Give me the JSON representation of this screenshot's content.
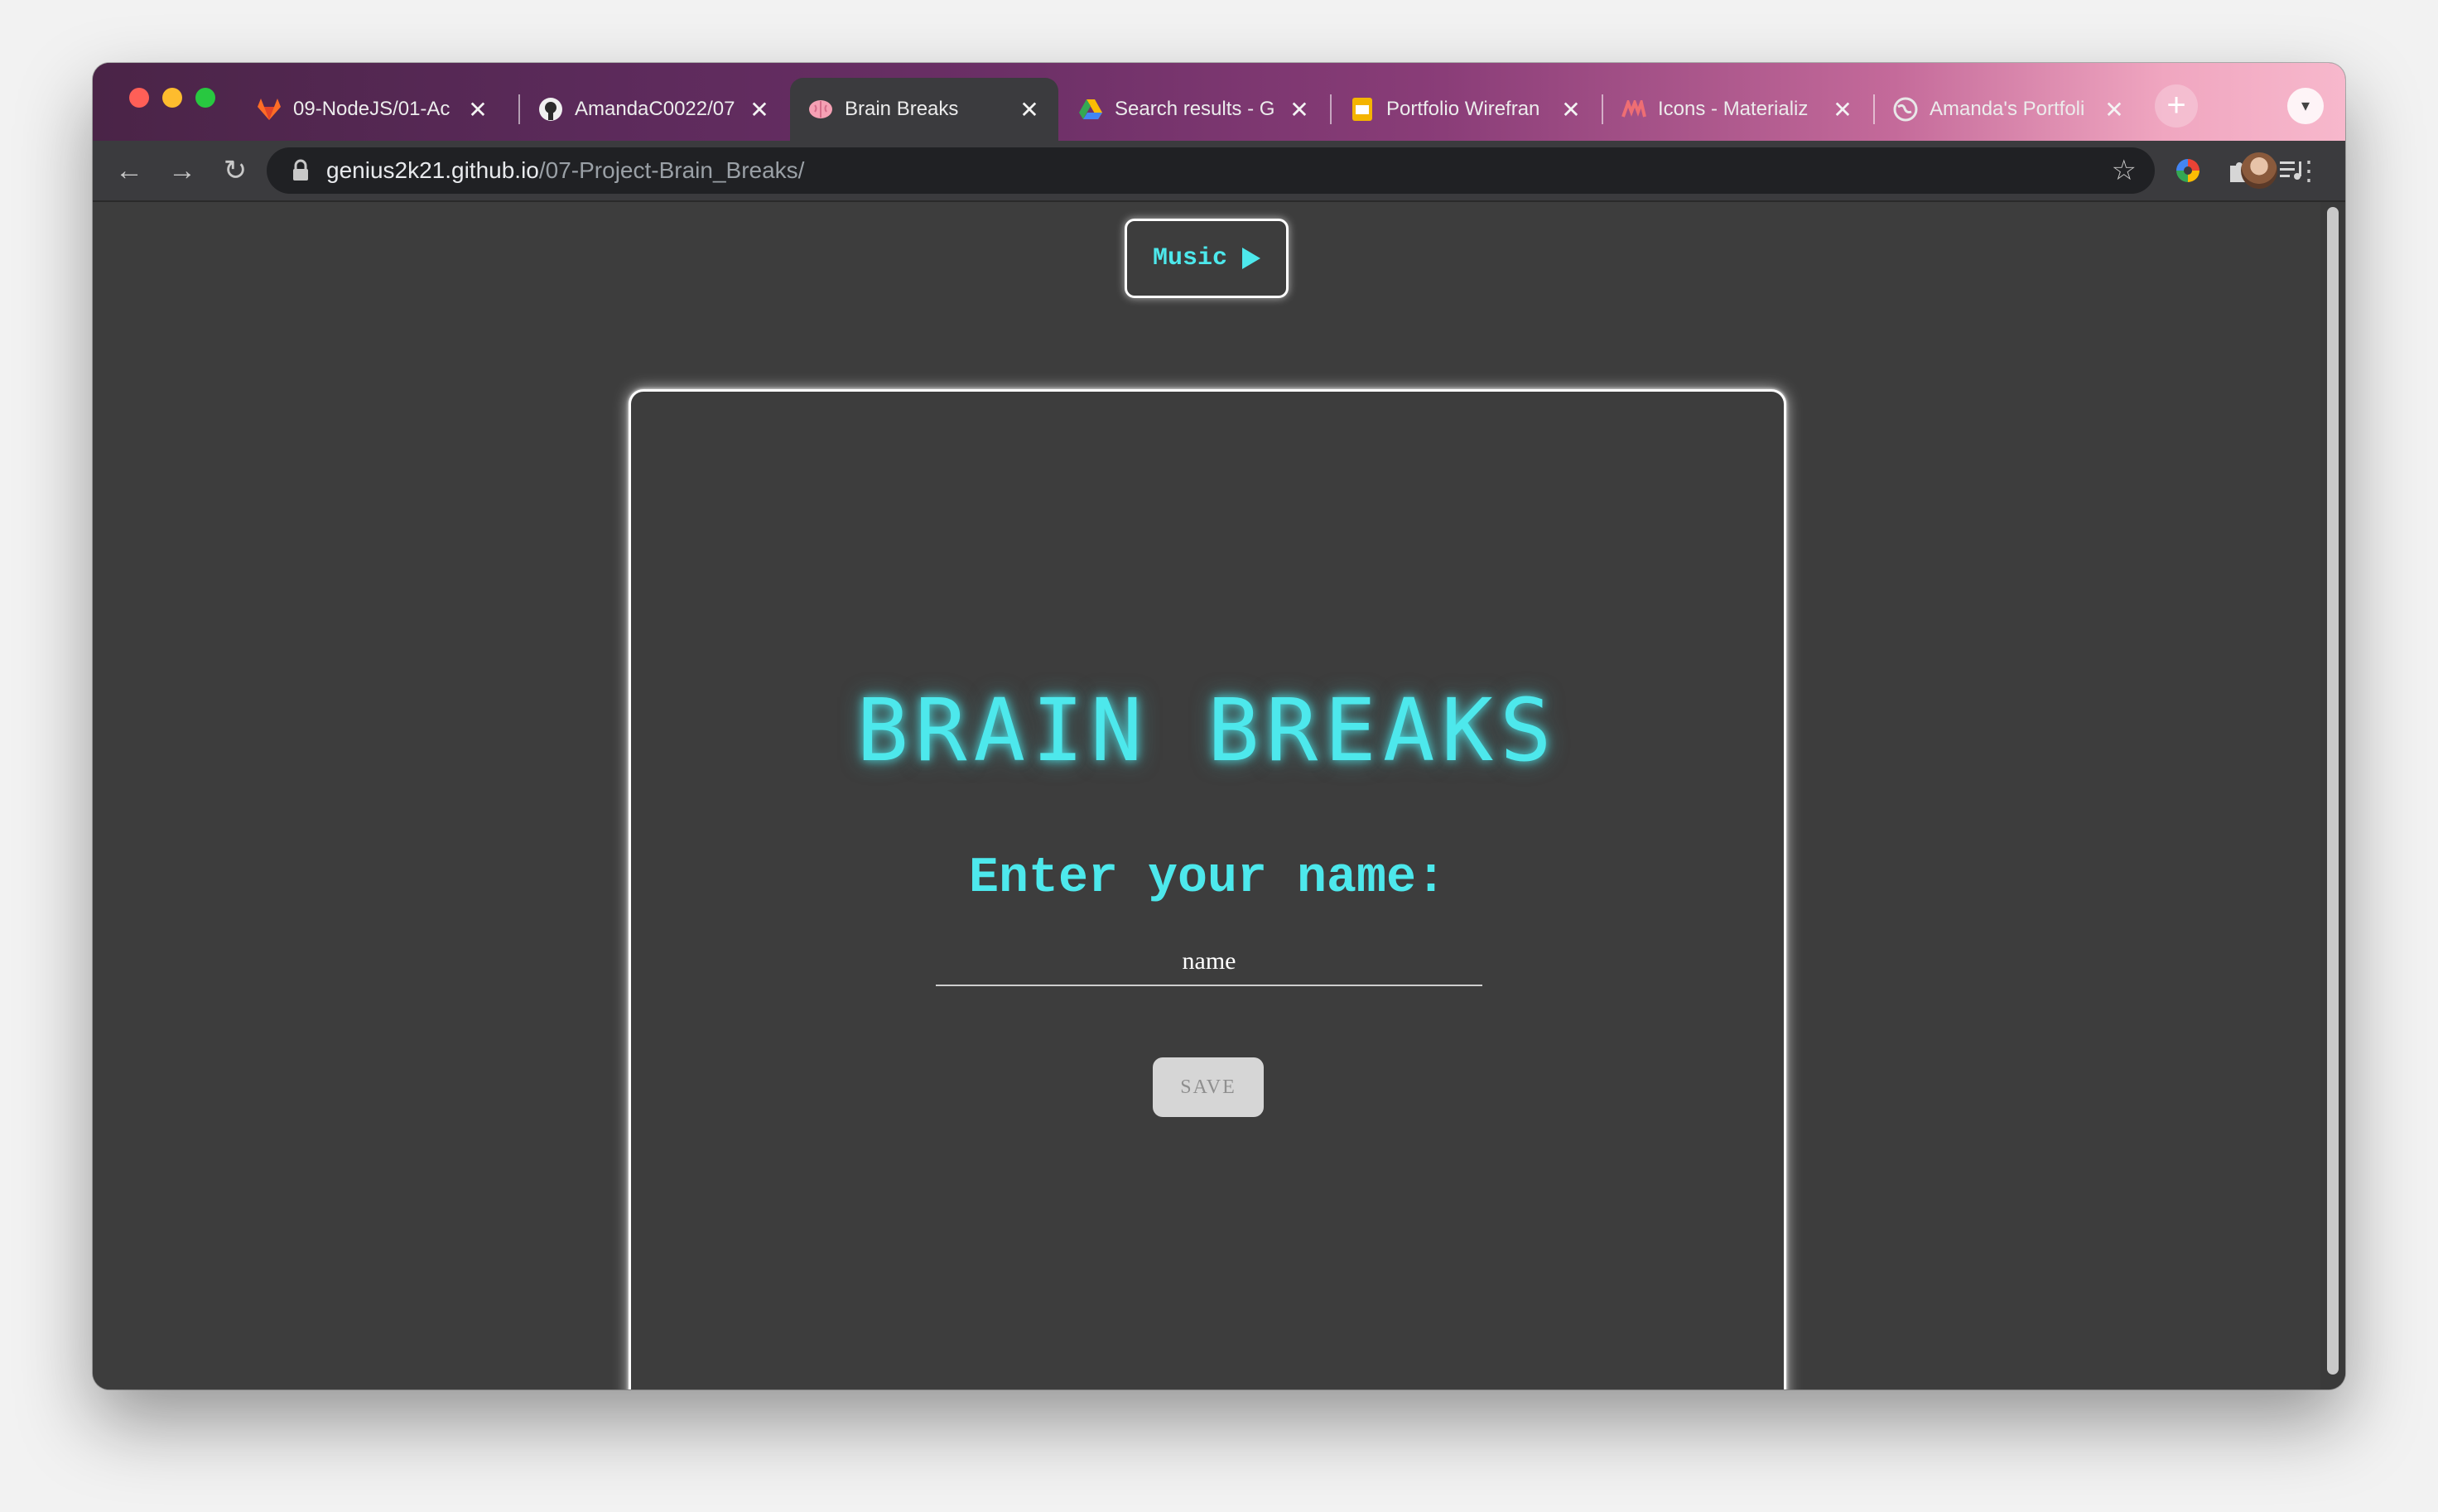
{
  "browser": {
    "tabs": [
      {
        "title": "09-NodeJS/01-Ac",
        "icon": "gitlab-icon"
      },
      {
        "title": "AmandaC0022/07",
        "icon": "github-icon"
      },
      {
        "title": "Brain Breaks",
        "icon": "brain-icon",
        "active": true
      },
      {
        "title": "Search results - G",
        "icon": "google-drive-icon"
      },
      {
        "title": "Portfolio Wirefran",
        "icon": "google-slides-icon"
      },
      {
        "title": "Icons - Materializ",
        "icon": "materialize-icon"
      },
      {
        "title": "Amanda's Portfoli",
        "icon": "globe-icon"
      }
    ],
    "url": {
      "host": "genius2k21.github.io",
      "path": "/07-Project-Brain_Breaks/"
    }
  },
  "page": {
    "music_button": "Music",
    "title": "BRAIN BREAKS",
    "prompt": "Enter your name:",
    "name_placeholder": "name",
    "save_button": "SAVE",
    "accent_color": "#4de8ec"
  }
}
